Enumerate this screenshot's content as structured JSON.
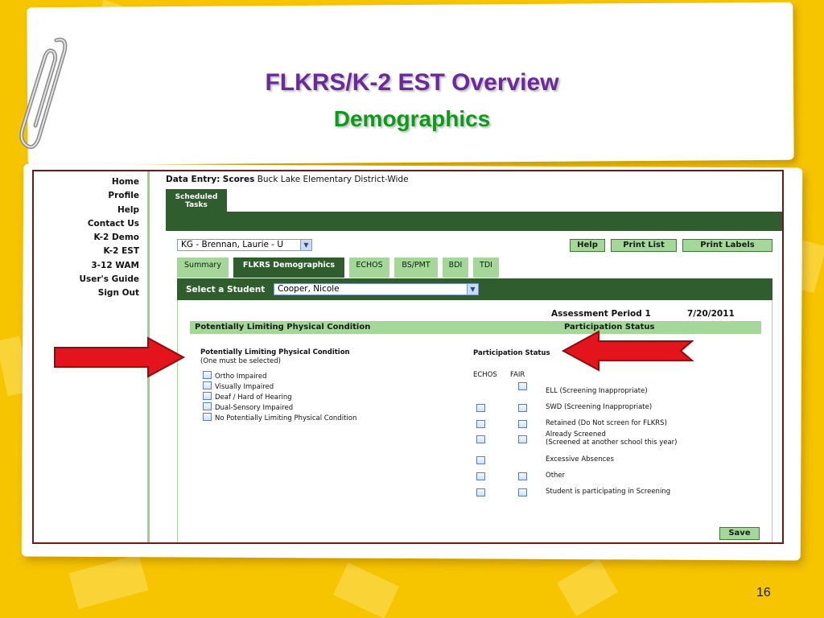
{
  "slide": {
    "title": "FLKRS/K-2 EST Overview",
    "subtitle": "Demographics",
    "number": "16"
  },
  "nav": [
    {
      "label": "Home"
    },
    {
      "label": "Profile"
    },
    {
      "label": "Help"
    },
    {
      "label": "Contact Us"
    },
    {
      "label": "K-2 Demo"
    },
    {
      "label": "K-2 EST"
    },
    {
      "label": "3-12 WAM"
    },
    {
      "label": "User's Guide"
    },
    {
      "label": "Sign Out"
    }
  ],
  "header": {
    "data_entry_label": "Data Entry:",
    "data_entry_value": "Scores",
    "school": "Buck Lake Elementary District-Wide",
    "scheduled_tasks": "Scheduled Tasks"
  },
  "class_select": {
    "value": "KG - Brennan, Laurie - U"
  },
  "buttons": {
    "help": "Help",
    "print_list": "Print List",
    "print_labels": "Print Labels",
    "save": "Save"
  },
  "tabs": [
    "Summary",
    "FLKRS Demographics",
    "ECHOS",
    "BS/PMT",
    "BDI",
    "TDI"
  ],
  "student": {
    "label": "Select a Student",
    "value": "Cooper, Nicole"
  },
  "assessment": {
    "period": "Assessment Period 1",
    "date": "7/20/2011"
  },
  "section_bar": {
    "left": "Potentially Limiting Physical Condition",
    "right": "Participation Status"
  },
  "physical": {
    "heading": "Potentially Limiting Physical Condition",
    "note": "(One must be selected)",
    "options": [
      "Ortho Impaired",
      "Visually Impaired",
      "Deaf / Hard of Hearing",
      "Dual-Sensory Impaired",
      "No Potentially Limiting Physical Condition"
    ]
  },
  "participation": {
    "heading": "Participation Status",
    "col_echos": "ECHOS",
    "col_fair": "FAIR",
    "rows": [
      {
        "label": "ELL (Screening Inappropriate)",
        "label2": "",
        "echos": false,
        "fair": true
      },
      {
        "label": "SWD (Screening Inappropriate)",
        "label2": "",
        "echos": true,
        "fair": true
      },
      {
        "label": "Retained (Do Not screen for FLKRS)",
        "label2": "",
        "echos": true,
        "fair": true
      },
      {
        "label": "Already Screened",
        "label2": "(Screened at another school this year)",
        "echos": true,
        "fair": true
      },
      {
        "label": "Excessive Absences",
        "label2": "",
        "echos": true,
        "fair": false
      },
      {
        "label": "Other",
        "label2": "",
        "echos": true,
        "fair": true
      },
      {
        "label": "Student is participating in Screening",
        "label2": "",
        "echos": true,
        "fair": true
      }
    ]
  },
  "colors": {
    "background": "#f7c400",
    "title": "#6a2a9a",
    "subtitle": "#0f9a1c",
    "dark_green": "#2f5d2e",
    "light_green": "#a6d79a",
    "arrow_red": "#e3141b"
  }
}
